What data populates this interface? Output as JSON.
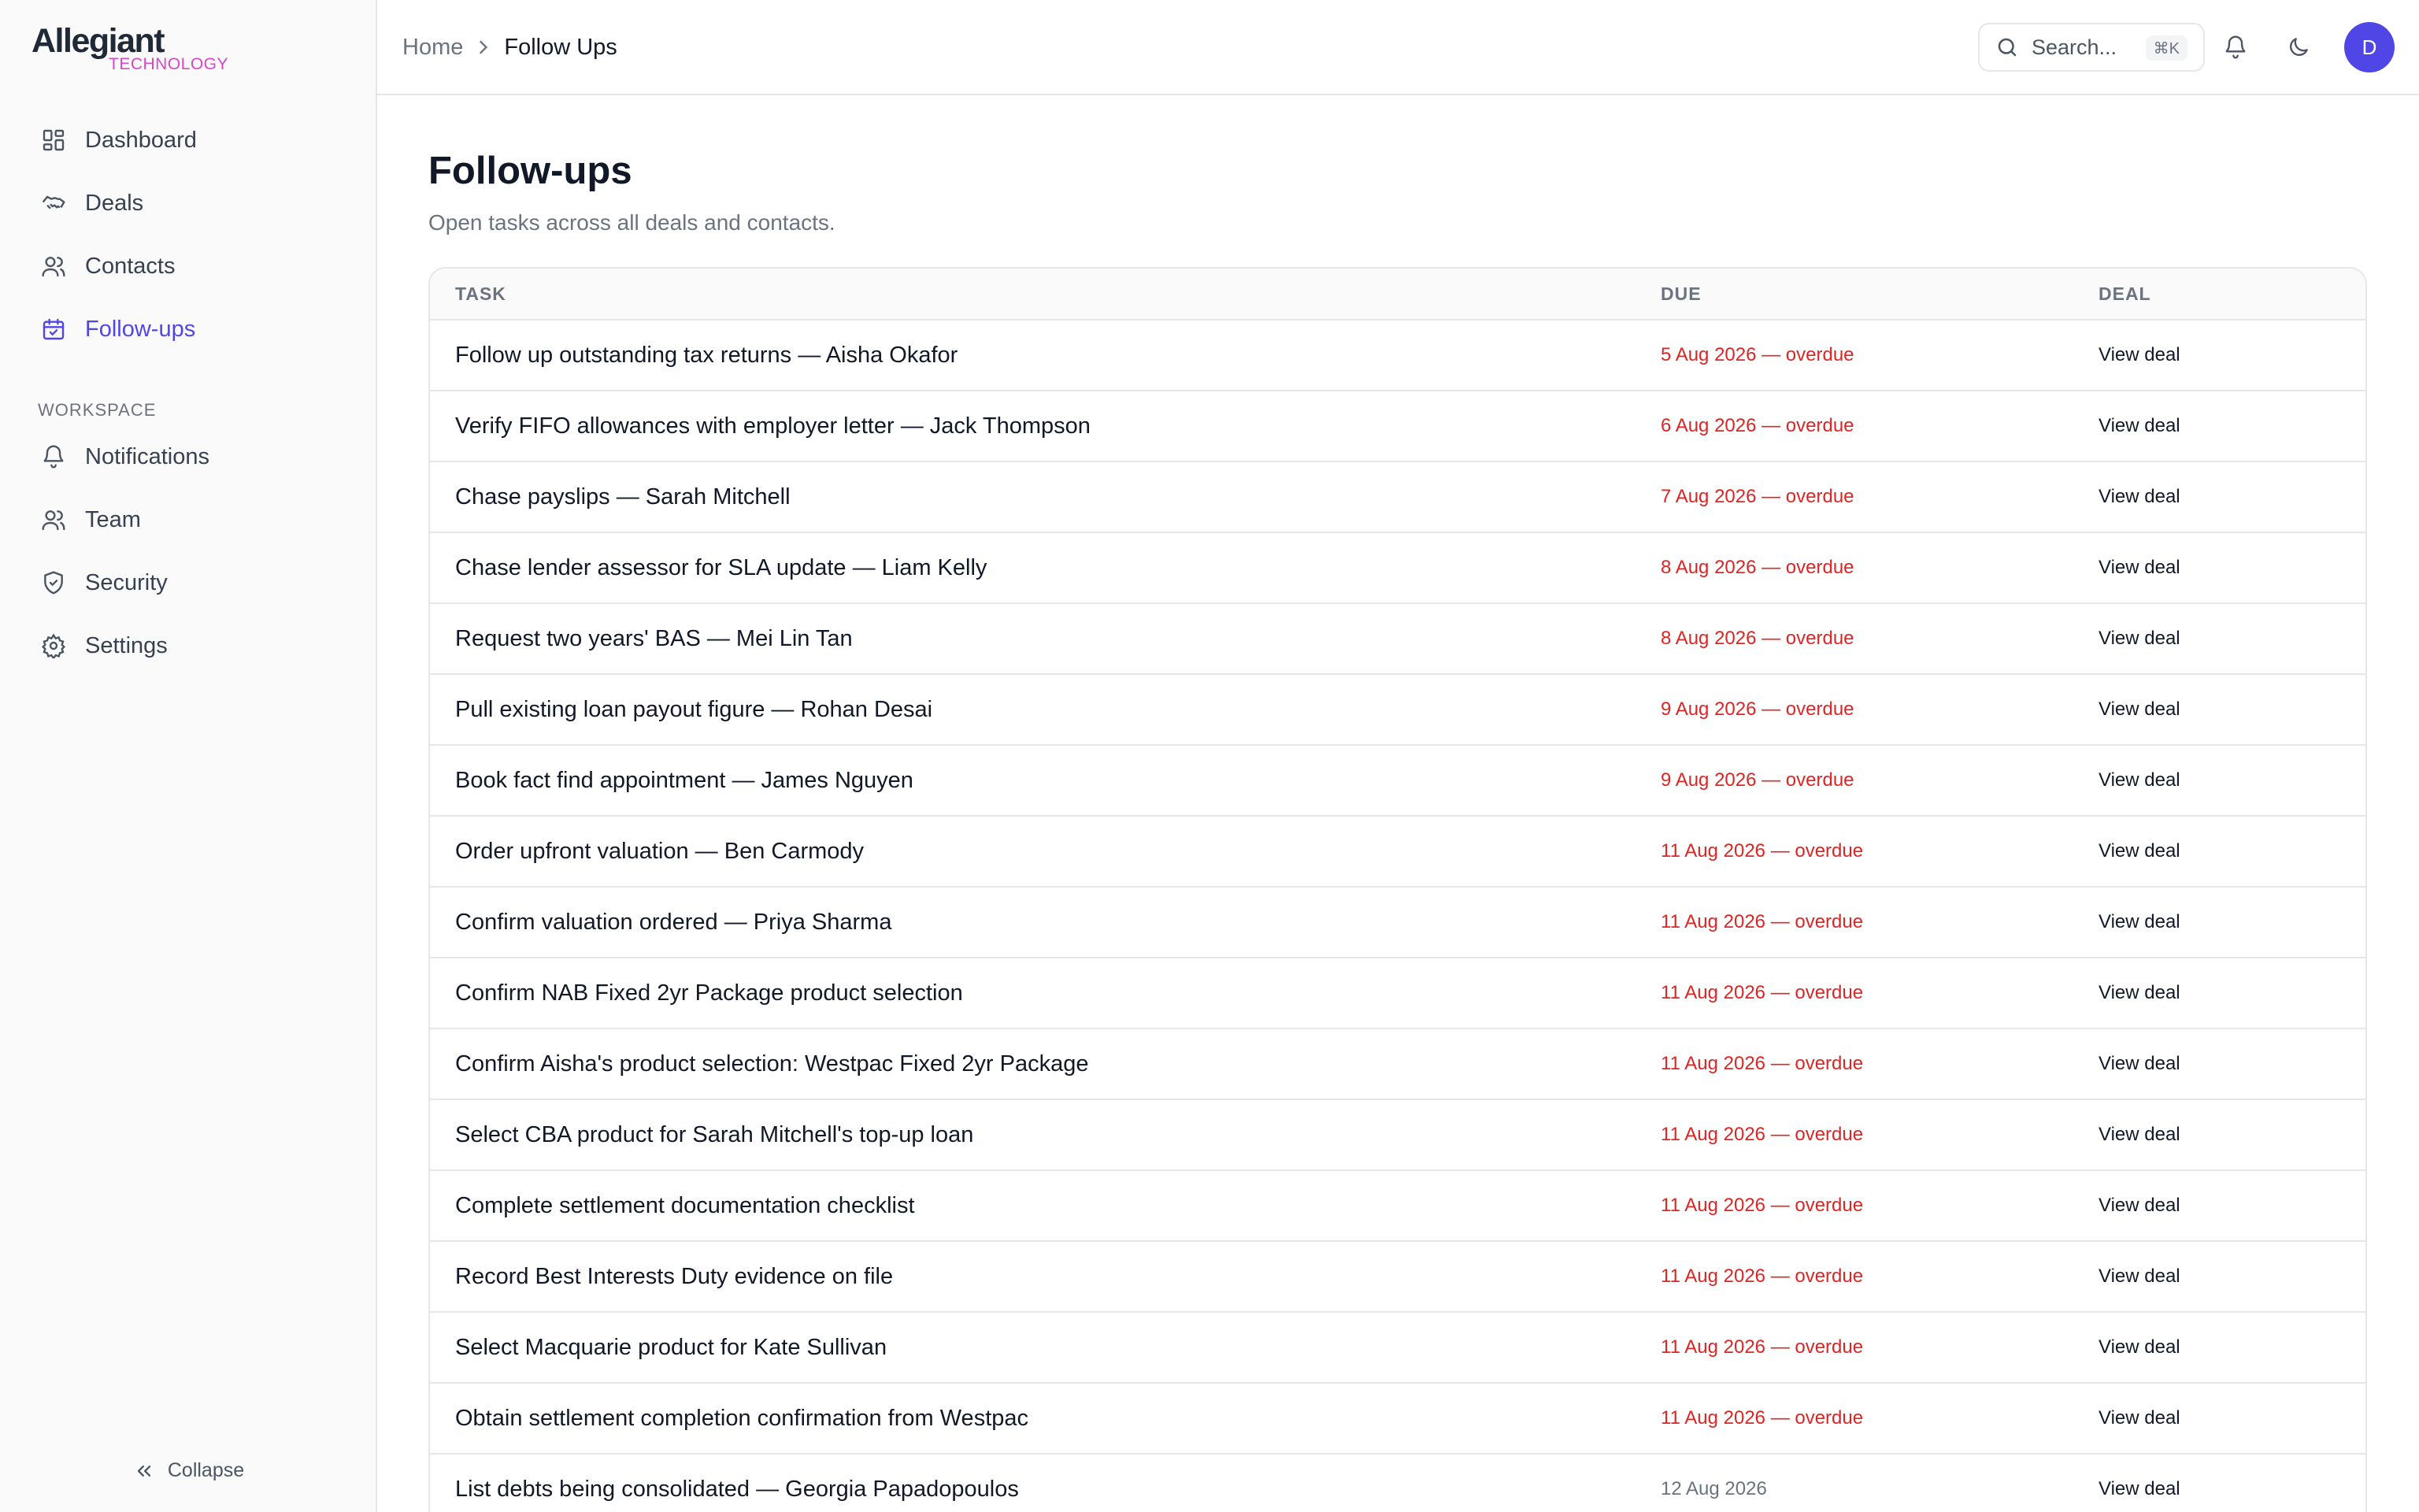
{
  "brand": {
    "name": "Allegiant",
    "sub": "TECHNOLOGY"
  },
  "sidebar": {
    "items": [
      {
        "label": "Dashboard",
        "icon": "dashboard-icon"
      },
      {
        "label": "Deals",
        "icon": "handshake-icon"
      },
      {
        "label": "Contacts",
        "icon": "users-icon"
      },
      {
        "label": "Follow-ups",
        "icon": "calendar-check-icon",
        "active": true
      }
    ],
    "section_label": "WORKSPACE",
    "workspace_items": [
      {
        "label": "Notifications",
        "icon": "bell-icon"
      },
      {
        "label": "Team",
        "icon": "users-icon"
      },
      {
        "label": "Security",
        "icon": "shield-icon"
      },
      {
        "label": "Settings",
        "icon": "gear-icon"
      }
    ],
    "collapse_label": "Collapse"
  },
  "header": {
    "breadcrumb": {
      "home": "Home",
      "current": "Follow Ups"
    },
    "search": {
      "placeholder": "Search...",
      "shortcut": "⌘K"
    },
    "avatar_initial": "D"
  },
  "page": {
    "title": "Follow-ups",
    "subtitle": "Open tasks across all deals and contacts."
  },
  "table": {
    "columns": {
      "task": "TASK",
      "due": "DUE",
      "deal": "DEAL"
    },
    "rows": [
      {
        "task": "Follow up outstanding tax returns — Aisha Okafor",
        "due": "5 Aug 2026 — overdue",
        "overdue": true,
        "deal": "View deal"
      },
      {
        "task": "Verify FIFO allowances with employer letter — Jack Thompson",
        "due": "6 Aug 2026 — overdue",
        "overdue": true,
        "deal": "View deal"
      },
      {
        "task": "Chase payslips — Sarah Mitchell",
        "due": "7 Aug 2026 — overdue",
        "overdue": true,
        "deal": "View deal"
      },
      {
        "task": "Chase lender assessor for SLA update — Liam Kelly",
        "due": "8 Aug 2026 — overdue",
        "overdue": true,
        "deal": "View deal"
      },
      {
        "task": "Request two years' BAS — Mei Lin Tan",
        "due": "8 Aug 2026 — overdue",
        "overdue": true,
        "deal": "View deal"
      },
      {
        "task": "Pull existing loan payout figure — Rohan Desai",
        "due": "9 Aug 2026 — overdue",
        "overdue": true,
        "deal": "View deal"
      },
      {
        "task": "Book fact find appointment — James Nguyen",
        "due": "9 Aug 2026 — overdue",
        "overdue": true,
        "deal": "View deal"
      },
      {
        "task": "Order upfront valuation — Ben Carmody",
        "due": "11 Aug 2026 — overdue",
        "overdue": true,
        "deal": "View deal"
      },
      {
        "task": "Confirm valuation ordered — Priya Sharma",
        "due": "11 Aug 2026 — overdue",
        "overdue": true,
        "deal": "View deal"
      },
      {
        "task": "Confirm NAB Fixed 2yr Package product selection",
        "due": "11 Aug 2026 — overdue",
        "overdue": true,
        "deal": "View deal"
      },
      {
        "task": "Confirm Aisha's product selection: Westpac Fixed 2yr Package",
        "due": "11 Aug 2026 — overdue",
        "overdue": true,
        "deal": "View deal"
      },
      {
        "task": "Select CBA product for Sarah Mitchell's top-up loan",
        "due": "11 Aug 2026 — overdue",
        "overdue": true,
        "deal": "View deal"
      },
      {
        "task": "Complete settlement documentation checklist",
        "due": "11 Aug 2026 — overdue",
        "overdue": true,
        "deal": "View deal"
      },
      {
        "task": "Record Best Interests Duty evidence on file",
        "due": "11 Aug 2026 — overdue",
        "overdue": true,
        "deal": "View deal"
      },
      {
        "task": "Select Macquarie product for Kate Sullivan",
        "due": "11 Aug 2026 — overdue",
        "overdue": true,
        "deal": "View deal"
      },
      {
        "task": "Obtain settlement completion confirmation from Westpac",
        "due": "11 Aug 2026 — overdue",
        "overdue": true,
        "deal": "View deal"
      },
      {
        "task": "List debts being consolidated — Georgia Papadopoulos",
        "due": "12 Aug 2026",
        "overdue": false,
        "deal": "View deal"
      }
    ]
  },
  "colors": {
    "accent": "#4f46e5",
    "overdue": "#dc2626",
    "brand_sub": "#d946c8"
  }
}
